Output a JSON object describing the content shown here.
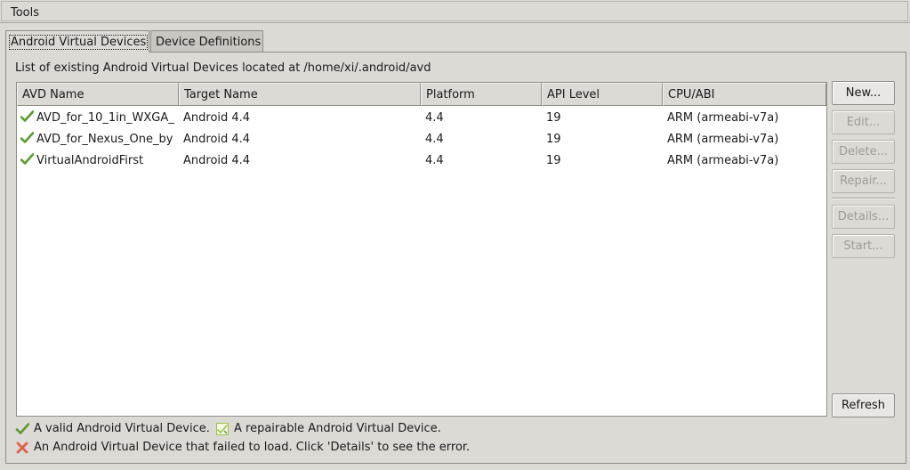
{
  "menu": {
    "tools_label": "Tools"
  },
  "tabs": [
    {
      "label": "Android Virtual Devices",
      "active": true
    },
    {
      "label": "Device Definitions",
      "active": false
    }
  ],
  "caption": "List of existing Android Virtual Devices located at /home/xi/.android/avd",
  "table": {
    "columns": [
      "AVD Name",
      "Target Name",
      "Platform",
      "API Level",
      "CPU/ABI"
    ],
    "rows": [
      {
        "status_icon": "check-icon",
        "name": "AVD_for_10_1in_WXGA_",
        "target": "Android 4.4",
        "platform": "4.4",
        "api": "19",
        "cpu": "ARM (armeabi-v7a)"
      },
      {
        "status_icon": "check-icon",
        "name": "AVD_for_Nexus_One_by",
        "target": "Android 4.4",
        "platform": "4.4",
        "api": "19",
        "cpu": "ARM (armeabi-v7a)"
      },
      {
        "status_icon": "check-icon",
        "name": "VirtualAndroidFirst",
        "target": "Android 4.4",
        "platform": "4.4",
        "api": "19",
        "cpu": "ARM (armeabi-v7a)"
      }
    ]
  },
  "buttons": {
    "new": "New...",
    "edit": "Edit...",
    "delete": "Delete...",
    "repair": "Repair...",
    "details": "Details...",
    "start": "Start...",
    "refresh": "Refresh"
  },
  "legend": {
    "valid": "A valid Android Virtual Device.",
    "repairable": "A repairable Android Virtual Device.",
    "failed": "An Android Virtual Device that failed to load. Click 'Details' to see the error."
  },
  "colors": {
    "check": "#5a9a2a",
    "error": "#e0604a",
    "repair": "#9cc24a"
  }
}
